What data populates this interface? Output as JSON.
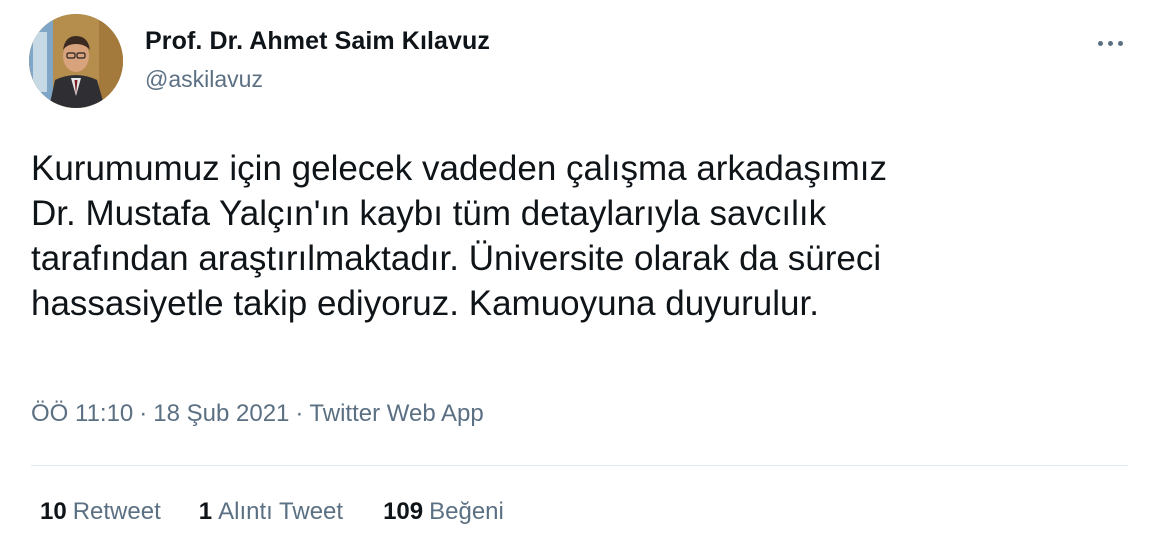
{
  "author": {
    "display_name": "Prof. Dr. Ahmet Saim Kılavuz",
    "handle": "@askilavuz",
    "avatar_icon": "profile-photo"
  },
  "more_icon": "more-horizontal-icon",
  "tweet": {
    "lines": [
      "Kurumumuz için gelecek vadeden çalışma arkadaşımız",
      "Dr. Mustafa Yalçın'ın kaybı tüm detaylarıyla savcılık",
      "tarafından araştırılmaktadır. Üniversite olarak da süreci",
      "hassasiyetle takip ediyoruz. Kamuoyuna duyurulur."
    ]
  },
  "meta": {
    "time": "ÖÖ 11:10",
    "separator": "·",
    "date": "18 Şub 2021",
    "source": "Twitter Web App"
  },
  "stats": {
    "retweets": {
      "count": "10",
      "label": "Retweet"
    },
    "quotes": {
      "count": "1",
      "label": "Alıntı Tweet"
    },
    "likes": {
      "count": "109",
      "label": "Beğeni"
    }
  },
  "colors": {
    "primary_text": "#0f1419",
    "secondary_text": "#5b7083",
    "divider": "#e1e8ed"
  }
}
